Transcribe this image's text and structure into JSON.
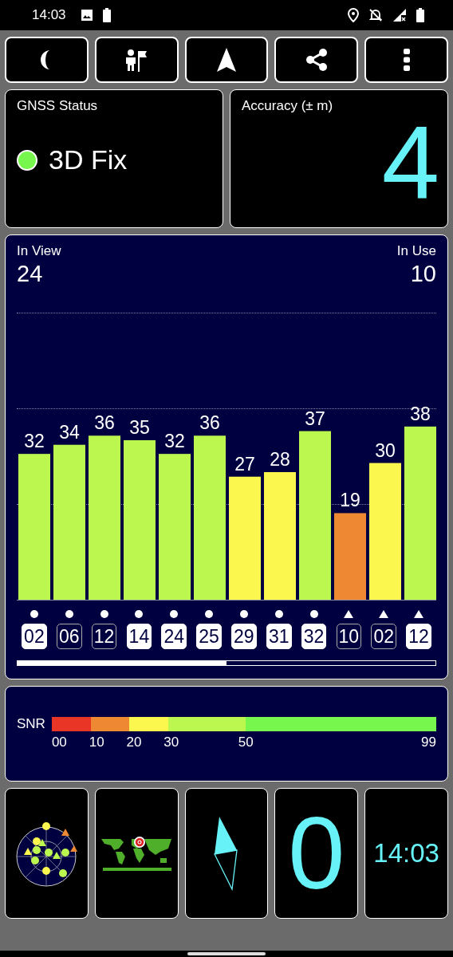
{
  "status_bar": {
    "time": "14:03"
  },
  "gnss_status": {
    "title": "GNSS Status",
    "fix": "3D Fix",
    "color": "#77f74e"
  },
  "accuracy": {
    "title": "Accuracy (± m)",
    "value": "4"
  },
  "satellites_panel": {
    "in_view_label": "In View",
    "in_view": "24",
    "in_use_label": "In Use",
    "in_use": "10",
    "chart_data": {
      "type": "bar",
      "categories": [
        "02",
        "06",
        "12",
        "14",
        "24",
        "25",
        "29",
        "31",
        "32",
        "10",
        "02",
        "12"
      ],
      "values": [
        32,
        34,
        36,
        35,
        32,
        36,
        27,
        28,
        37,
        19,
        30,
        38
      ],
      "data_labels": true
    },
    "satellites": [
      {
        "kind": "dot",
        "selected": true,
        "color": "#bbf74e"
      },
      {
        "kind": "dot",
        "selected": false,
        "color": "#bbf74e"
      },
      {
        "kind": "dot",
        "selected": false,
        "color": "#bbf74e"
      },
      {
        "kind": "dot",
        "selected": true,
        "color": "#bbf74e"
      },
      {
        "kind": "dot",
        "selected": true,
        "color": "#bbf74e"
      },
      {
        "kind": "dot",
        "selected": true,
        "color": "#bbf74e"
      },
      {
        "kind": "dot",
        "selected": true,
        "color": "#fbf74e"
      },
      {
        "kind": "dot",
        "selected": true,
        "color": "#fbf74e"
      },
      {
        "kind": "dot",
        "selected": true,
        "color": "#bbf74e"
      },
      {
        "kind": "triangle",
        "selected": false,
        "color": "#ee8833"
      },
      {
        "kind": "triangle",
        "selected": false,
        "color": "#fbf74e"
      },
      {
        "kind": "triangle",
        "selected": true,
        "color": "#bbf74e"
      }
    ]
  },
  "snr": {
    "label": "SNR",
    "segments": [
      {
        "tick": "00",
        "color": "#e83525"
      },
      {
        "tick": "10",
        "color": "#ee8833"
      },
      {
        "tick": "20",
        "color": "#fbf74e"
      },
      {
        "tick": "30",
        "color": "#bbf74e"
      },
      {
        "tick": "50",
        "color": "#77f74e"
      }
    ],
    "end_tick": "99"
  },
  "tiles": {
    "speed": "0",
    "clock": "14:03"
  }
}
